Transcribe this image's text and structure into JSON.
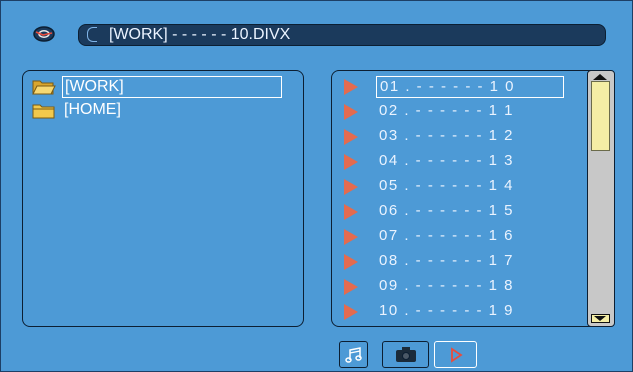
{
  "header": {
    "icon": "disc-icon",
    "title": "[WORK] - - - - - - 10.DIVX"
  },
  "folders": [
    {
      "label": "[WORK]",
      "icon": "open-folder-icon",
      "selected": true
    },
    {
      "label": "[HOME]",
      "icon": "folder-icon",
      "selected": false
    }
  ],
  "files": [
    {
      "label": "01 . - - - - - - 1 0",
      "selected": true
    },
    {
      "label": "02 . - - - - - - 1 1"
    },
    {
      "label": "03 . - - - - - - 1 2"
    },
    {
      "label": "04 . - - - - - - 1 3"
    },
    {
      "label": "05 . - - - - - - 1 4"
    },
    {
      "label": "06 . - - - - - - 1 5"
    },
    {
      "label": "07 . - - - - - - 1 6"
    },
    {
      "label": "08 . - - - - - - 1 7"
    },
    {
      "label": "09 . - - - - - - 1 8"
    },
    {
      "label": "10 . - - - - - - 1 9"
    }
  ],
  "modes": [
    {
      "icon": "music-note-icon"
    },
    {
      "icon": "camera-icon"
    },
    {
      "icon": "play-icon",
      "active": true
    }
  ],
  "colors": {
    "background": "#4d9ad6",
    "title_bar": "#1b3a5c",
    "play_marker": "#e46b4f",
    "folder": "#f2c94c",
    "scroll_thumb": "#f5eea5"
  }
}
